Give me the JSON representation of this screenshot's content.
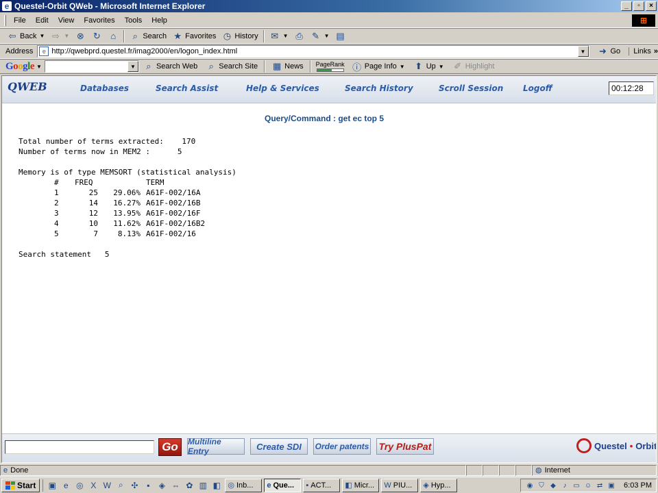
{
  "window": {
    "title": "Questel-Orbit QWeb - Microsoft Internet Explorer"
  },
  "menu": [
    "File",
    "Edit",
    "View",
    "Favorites",
    "Tools",
    "Help"
  ],
  "toolbar": {
    "back": "Back",
    "search": "Search",
    "favorites": "Favorites",
    "history": "History"
  },
  "address": {
    "label": "Address",
    "url": "http://qwebprd.questel.fr/imag2000/en/logon_index.html",
    "go": "Go",
    "links": "Links"
  },
  "google": {
    "logo": [
      "G",
      "o",
      "o",
      "g",
      "l",
      "e"
    ],
    "search_web": "Search Web",
    "search_site": "Search Site",
    "news": "News",
    "pagerank": "PageRank",
    "pagerank_fill": 0.55,
    "page_info": "Page Info",
    "up": "Up",
    "highlight": "Highlight"
  },
  "qweb": {
    "logo": "QWEB",
    "nav": [
      "Databases",
      "Search Assist",
      "Help & Services",
      "Search History",
      "Scroll Session",
      "Logoff"
    ],
    "timer": "00:12:28"
  },
  "query": {
    "title": "Query/Command : get ec top 5"
  },
  "results": {
    "total_label": "Total number of terms extracted:",
    "total_value": "170",
    "mem2_label": "Number of terms now in MEM2 :",
    "mem2_value": "5",
    "memory_type": "Memory is of type MEMSORT (statistical analysis)",
    "headers": [
      "#",
      "FREQ",
      "TERM"
    ],
    "rows": [
      {
        "num": "1",
        "freq": "25",
        "pct": "29.06%",
        "term": "A61F-002/16A"
      },
      {
        "num": "2",
        "freq": "14",
        "pct": "16.27%",
        "term": "A61F-002/16B"
      },
      {
        "num": "3",
        "freq": "12",
        "pct": "13.95%",
        "term": "A61F-002/16F"
      },
      {
        "num": "4",
        "freq": "10",
        "pct": "11.62%",
        "term": "A61F-002/16B2"
      },
      {
        "num": "5",
        "freq": "7",
        "pct": "8.13%",
        "term": "A61F-002/16"
      }
    ],
    "search_statement_label": "Search statement",
    "search_statement_value": "5"
  },
  "command": {
    "input_value": "",
    "go": "Go",
    "buttons": {
      "multiline": "Multiline Entry",
      "create_sdi": "Create SDI",
      "order": "Order patents",
      "try": "Try",
      "pluspat": "PlusPat"
    },
    "brand_left": "Questel",
    "brand_dot": "•",
    "brand_right": "Orbit"
  },
  "status": {
    "text": "Done",
    "zone": "Internet"
  },
  "taskbar": {
    "start": "Start",
    "tasks": [
      "Inb...",
      "Que...",
      "ACT...",
      "Micr...",
      "PIU...",
      "Hyp..."
    ],
    "active_index": 1,
    "clock": "6:03 PM"
  }
}
